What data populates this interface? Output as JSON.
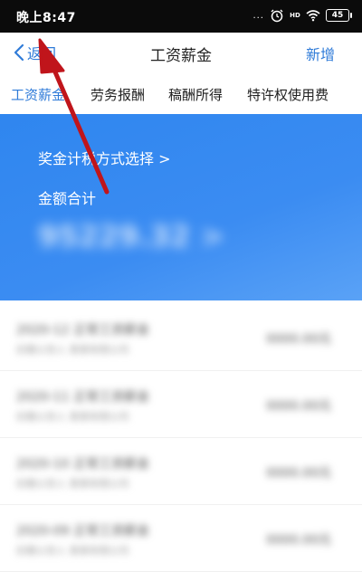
{
  "status_bar": {
    "time": "晚上8:47",
    "signal_dots": "...",
    "hd_label": "HD",
    "battery": "45"
  },
  "nav": {
    "back_label": "返回",
    "title": "工资薪金",
    "add_label": "新增"
  },
  "tabs": [
    {
      "label": "工资薪金",
      "active": true
    },
    {
      "label": "劳务报酬",
      "active": false
    },
    {
      "label": "稿酬所得",
      "active": false
    },
    {
      "label": "特许权使用费",
      "active": false
    }
  ],
  "hero": {
    "method_link": "奖金计税方式选择 >",
    "total_label": "金额合计",
    "total_amount": "95229.32 >"
  },
  "list": [
    {
      "title": "2020-12 正常工资薪金",
      "sub": "扣缴义务人 某某有限公司",
      "amount": "0000.00元"
    },
    {
      "title": "2020-11 正常工资薪金",
      "sub": "扣缴义务人 某某有限公司",
      "amount": "0000.00元"
    },
    {
      "title": "2020-10 正常工资薪金",
      "sub": "扣缴义务人 某某有限公司",
      "amount": "0000.00元"
    },
    {
      "title": "2020-09 正常工资薪金",
      "sub": "扣缴义务人 某某有限公司",
      "amount": "0000.00元"
    }
  ],
  "colors": {
    "accent": "#2f7bd8",
    "hero_blue": "#3b8cf2",
    "arrow_red": "#c0151b",
    "status_bar": "#0b0b0b"
  },
  "icons": {
    "back": "chevron-left-icon",
    "alarm": "alarm-icon",
    "wifi": "wifi-icon",
    "battery": "battery-icon"
  }
}
